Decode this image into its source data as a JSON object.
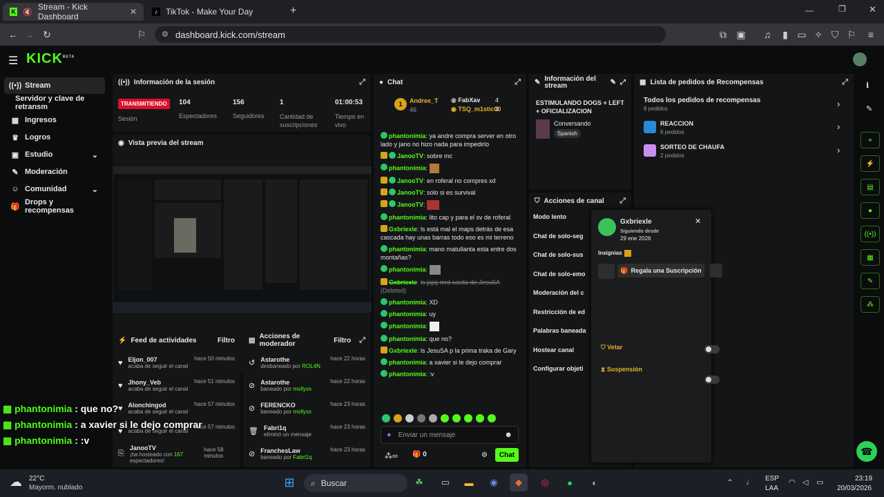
{
  "browser": {
    "tabs": [
      {
        "title": "Stream - Kick Dashboard"
      },
      {
        "title": "TikTok - Make Your Day"
      }
    ],
    "url": "dashboard.kick.com/stream"
  },
  "logo": "KICK",
  "logo_beta": "BETA",
  "sidebar": {
    "items": [
      {
        "label": "Stream"
      },
      {
        "label": "Servidor y clave de retransm"
      },
      {
        "label": "Ingresos"
      },
      {
        "label": "Logros"
      },
      {
        "label": "Estudio"
      },
      {
        "label": "Moderación"
      },
      {
        "label": "Comunidad"
      },
      {
        "label": "Drops y recompensas"
      }
    ]
  },
  "session": {
    "title": "Información de la sesión",
    "status": "TRANSMITIENDO",
    "status_label": "Sesión",
    "stats": [
      {
        "value": "104",
        "label": "Espectadores"
      },
      {
        "value": "156",
        "label": "Seguidores"
      },
      {
        "value": "1",
        "label": "Cantidad de suscripciones"
      },
      {
        "value": "01:00:53",
        "label": "Tiempo en vivo"
      }
    ]
  },
  "preview": {
    "title": "Vista previa del stream"
  },
  "activity": {
    "title": "Feed de actividades",
    "filter": "Filtro",
    "items": [
      {
        "name": "Eljon_007",
        "desc": "acaba de seguir el canal",
        "time": "hace 50 minutos"
      },
      {
        "name": "Jhony_Veb",
        "desc": "acaba de seguir el canal",
        "time": "hace 51 minutos"
      },
      {
        "name": "Alonchingod",
        "desc": "acaba de seguir el canal",
        "time": "hace 57 minutos"
      },
      {
        "name": "",
        "desc": "acaba de seguir el canal",
        "time": "hace 57 minutos"
      },
      {
        "name": "JanooTV",
        "desc": "¡ha hosteado con",
        "desc_count": "167",
        "desc_end": "espectadores!",
        "time": "hace 58 minutos"
      }
    ]
  },
  "modactions": {
    "title": "Acciones de moderador",
    "filter": "Filtro",
    "items": [
      {
        "name": "Astarothe",
        "desc": "desbaneado por",
        "by": "ROL4N",
        "time": "hace 22 horas"
      },
      {
        "name": "Astarothe",
        "desc": "baneado por",
        "by": "mollyxs",
        "time": "hace 22 horas"
      },
      {
        "name": "FERENCKO",
        "desc": "baneado por",
        "by": "mollyxs",
        "time": "hace 23 horas"
      },
      {
        "name": "Fabri1q",
        "desc": "eliminó un mensaje",
        "by": "",
        "time": "hace 23 horas"
      },
      {
        "name": "FranchesLaw",
        "desc": "baneado por",
        "by": "Fabri1q",
        "time": "hace 23 horas"
      }
    ]
  },
  "chat": {
    "title": "Chat",
    "leaders": [
      {
        "rank": "1",
        "name": "Andree_T",
        "count": "46"
      },
      {
        "name": "FabXav",
        "count": "4"
      },
      {
        "name": "TSQ_m1stic00",
        "count": "3"
      }
    ],
    "messages": [
      {
        "user": "phantonimia",
        "text": "ya andre compra server en otro lado y jano no hizo nada para impedirlo",
        "color": "#53fc18"
      },
      {
        "user": "JanooTV",
        "text": "sobre mc",
        "color": "#53fc18"
      },
      {
        "user": "phantonimia",
        "text": "",
        "color": "#53fc18"
      },
      {
        "user": "JanooTV",
        "text": "en roferal no compres xd",
        "color": "#53fc18"
      },
      {
        "user": "JanooTV",
        "text": "solo si es survival",
        "color": "#53fc18"
      },
      {
        "user": "JanooTV",
        "text": "",
        "color": "#53fc18"
      },
      {
        "user": "phantonimia",
        "text": "lito cap y para el sv de roferal",
        "color": "#53fc18"
      },
      {
        "user": "Gxbriexle",
        "text": "ls está mal el maps detrás de esa cascada hay unas barras todo eso es mi terreno",
        "color": "#53fc18"
      },
      {
        "user": "phantonimia",
        "text": "mano matullanta esta entre dos montañas?",
        "color": "#53fc18"
      },
      {
        "user": "phantonimia",
        "text": "",
        "color": "#53fc18"
      },
      {
        "user": "Gxbriexle",
        "text": "ls jajaj mrd casita de JesuSA",
        "deleted": "(Deleted)",
        "color": "#53fc18"
      },
      {
        "user": "phantonimia",
        "text": "XD",
        "color": "#53fc18"
      },
      {
        "user": "phantonimia",
        "text": "uy",
        "color": "#53fc18"
      },
      {
        "user": "phantonimia",
        "text": "",
        "color": "#53fc18"
      },
      {
        "user": "phantonimia",
        "text": "que no?",
        "color": "#53fc18"
      },
      {
        "user": "Gxbriexle",
        "text": "ls JesuSA p la prima traka de Gary",
        "color": "#53fc18"
      },
      {
        "user": "phantonimia",
        "text": "a xavier si le dejo comprar",
        "color": "#53fc18"
      },
      {
        "user": "phantonimia",
        "text": ":v",
        "color": "#53fc18"
      }
    ],
    "placeholder": "Enviar un mensaje",
    "points": "0",
    "send": "Chat"
  },
  "streaminfo": {
    "title": "Información del stream",
    "stream_title": "ESTIMULANDO DOGS + LEFT + OFICIALIZACION",
    "category": "Conversando",
    "tag": "Spanish"
  },
  "channel": {
    "title": "Acciones de canal",
    "items": [
      "Modo lento",
      "Chat de solo-seg",
      "Chat de solo-sus",
      "Chat de solo-emo",
      "Moderación del c",
      "Restricción de ed",
      "Palabras baneada",
      "Hostear canal",
      "Configurar objeti"
    ]
  },
  "rewards": {
    "title": "Lista de pedidos de Recompensas",
    "all": "Todos los pedidos de recompensas",
    "all_count": "8 pedidos",
    "items": [
      {
        "name": "REACCION",
        "count": "6 pedidos"
      },
      {
        "name": "SORTEO DE CHAUFA",
        "count": "2 pedidos"
      }
    ]
  },
  "usercard": {
    "name": "Gxbriexle",
    "following_label": "Siguiendo desde",
    "following_date": "29 ene 2026",
    "badges_label": "Insignias",
    "gift": "Regala una Suscripción",
    "ban": "Vetar",
    "timeout": "Suspensión"
  },
  "overlay": [
    {
      "user": "phantonimia",
      "text": ": que no?"
    },
    {
      "user": "phantonimia",
      "text": ": a xavier si le dejo comprar"
    },
    {
      "user": "phantonimia",
      "text": ": :v"
    }
  ],
  "taskbar": {
    "temp": "22°C",
    "weather": "Mayorm. nublado",
    "search": "Buscar",
    "lang1": "ESP",
    "lang2": "LAA",
    "time": "23:19",
    "date": "20/03/2026"
  }
}
